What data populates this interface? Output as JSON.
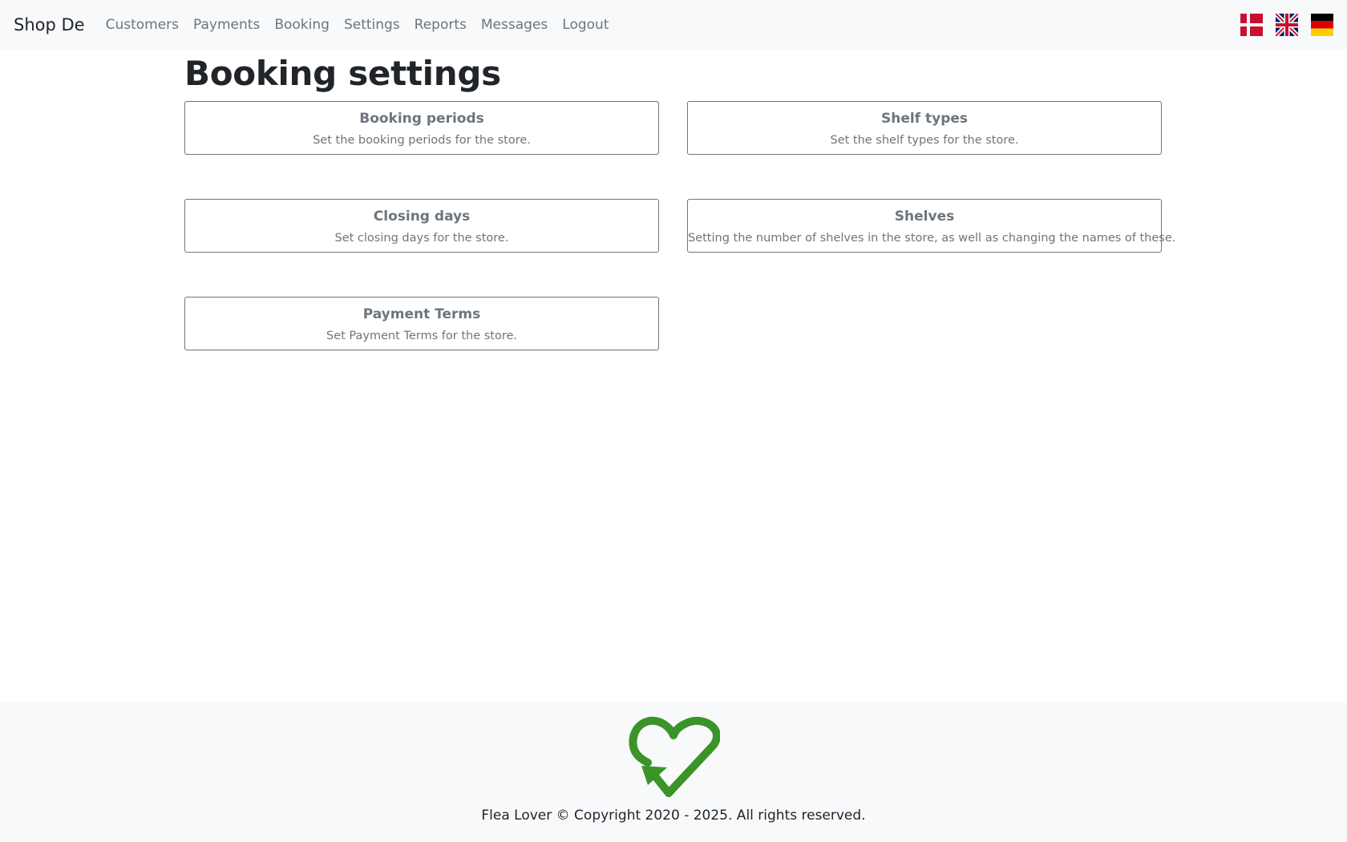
{
  "navbar": {
    "brand": "Shop De",
    "links": [
      {
        "label": "Customers"
      },
      {
        "label": "Payments"
      },
      {
        "label": "Booking"
      },
      {
        "label": "Settings"
      },
      {
        "label": "Reports"
      },
      {
        "label": "Messages"
      },
      {
        "label": "Logout"
      }
    ],
    "flags": [
      "danish-flag-icon",
      "uk-flag-icon",
      "german-flag-icon"
    ]
  },
  "main": {
    "title": "Booking settings",
    "cards": [
      {
        "title": "Booking periods",
        "description": "Set the booking periods for the store."
      },
      {
        "title": "Shelf types",
        "description": "Set the shelf types for the store."
      },
      {
        "title": "Closing days",
        "description": "Set closing days for the store."
      },
      {
        "title": "Shelves",
        "description": "Setting the number of shelves in the store, as well as changing the names of these."
      },
      {
        "title": "Payment Terms",
        "description": "Set Payment Terms for the store."
      }
    ]
  },
  "footer": {
    "logo_icon": "recycle-heart-logo-icon",
    "copyright": "Flea Lover © Copyright 2020 - 2025. All rights reserved."
  },
  "colors": {
    "navbar_bg": "#f8f9fa",
    "muted_text": "#6c757d",
    "logo_green": "#3a9428"
  }
}
